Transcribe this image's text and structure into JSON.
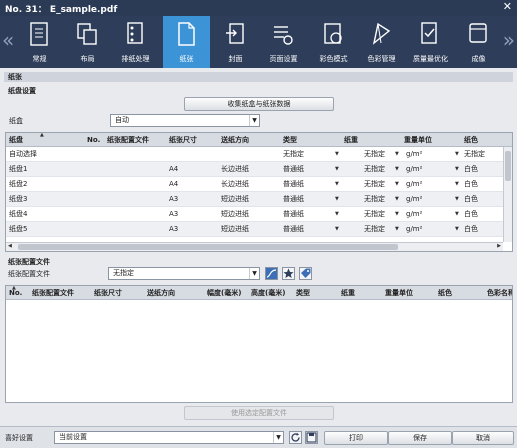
{
  "window": {
    "title": "No. 31： E_sample.pdf"
  },
  "toolbar": {
    "items": [
      {
        "label": "常规",
        "icon": "settings-list-icon"
      },
      {
        "label": "布局",
        "icon": "layout-icon"
      },
      {
        "label": "排纸处理",
        "icon": "finishing-icon"
      },
      {
        "label": "纸张",
        "icon": "paper-icon"
      },
      {
        "label": "封面",
        "icon": "cover-icon"
      },
      {
        "label": "页面设置",
        "icon": "page-setup-icon"
      },
      {
        "label": "彩色模式",
        "icon": "color-mode-icon"
      },
      {
        "label": "色彩管理",
        "icon": "color-management-icon"
      },
      {
        "label": "质量最优化",
        "icon": "quality-icon"
      },
      {
        "label": "成像",
        "icon": "imaging-icon"
      }
    ],
    "active": 3
  },
  "paper_section": {
    "header": "纸张",
    "tray_settings_label": "纸盘设置",
    "collect_button": "收集纸盒与纸张数据",
    "tray_label": "纸盒",
    "tray_value": "自动"
  },
  "tray_table": {
    "headers": [
      "纸盘",
      "No.",
      "纸张配置文件",
      "纸张尺寸",
      "送纸方向",
      "类型",
      "纸重",
      "重量单位",
      "纸色"
    ],
    "rows": [
      {
        "tray": "自动选择",
        "size": "",
        "dir": "",
        "type": "无指定",
        "weight": "无指定",
        "unit": "g/m²",
        "color": "无指定"
      },
      {
        "tray": "纸盘1",
        "size": "A4",
        "dir": "长边进纸",
        "type": "普通纸",
        "weight": "无指定",
        "unit": "g/m²",
        "color": "白色"
      },
      {
        "tray": "纸盘2",
        "size": "A4",
        "dir": "长边进纸",
        "type": "普通纸",
        "weight": "无指定",
        "unit": "g/m²",
        "color": "白色"
      },
      {
        "tray": "纸盘3",
        "size": "A3",
        "dir": "短边进纸",
        "type": "普通纸",
        "weight": "无指定",
        "unit": "g/m²",
        "color": "白色"
      },
      {
        "tray": "纸盘4",
        "size": "A3",
        "dir": "短边进纸",
        "type": "普通纸",
        "weight": "无指定",
        "unit": "g/m²",
        "color": "白色"
      },
      {
        "tray": "纸盘5",
        "size": "A3",
        "dir": "短边进纸",
        "type": "普通纸",
        "weight": "无指定",
        "unit": "g/m²",
        "color": "白色"
      }
    ]
  },
  "profile_section": {
    "header": "纸张配置文件",
    "file_label": "纸张配置文件",
    "file_value": "无指定",
    "use_button": "使用选定配置文件"
  },
  "profile_table": {
    "headers": [
      "No.",
      "纸张配置文件",
      "纸张尺寸",
      "送纸方向",
      "幅度(毫米)",
      "高度(毫米)",
      "类型",
      "纸重",
      "重量单位",
      "纸色",
      "色彩名称"
    ]
  },
  "bottom": {
    "preset_label": "喜好设置",
    "preset_value": "当前设置",
    "print": "打印",
    "save": "保存",
    "cancel": "取消"
  },
  "colors": {
    "titlebar": "#2b3a55",
    "toolbar": "#2e3e5a",
    "active_tab": "#3c94d6"
  }
}
